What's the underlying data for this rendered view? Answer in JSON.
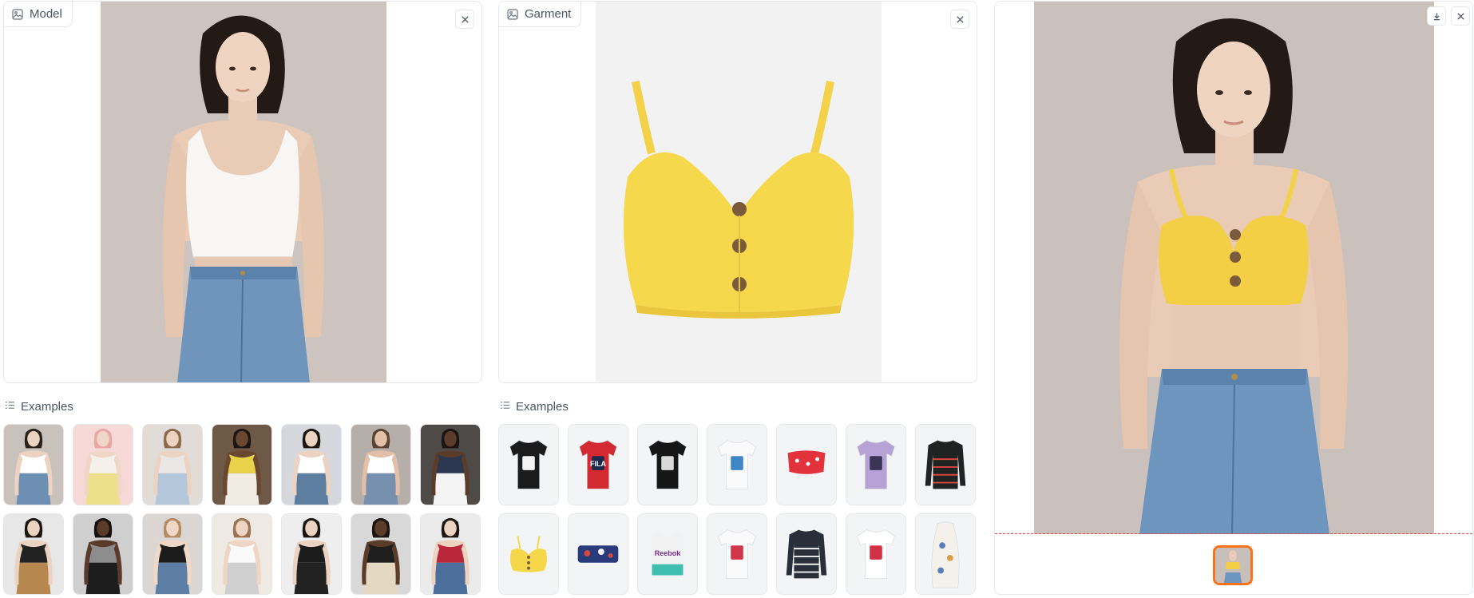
{
  "model_panel": {
    "label": "Model",
    "icon": "image-icon",
    "close_icon": "close-icon"
  },
  "garment_panel": {
    "label": "Garment",
    "icon": "image-icon",
    "close_icon": "close-icon"
  },
  "result_panel": {
    "download_icon": "download-icon",
    "close_icon": "close-icon"
  },
  "model_examples": {
    "label": "Examples",
    "items": [
      {
        "name": "model-white-tank-jeans",
        "top": "#ffffff",
        "bottom": "#6d8fb3",
        "bg": "#c9c1bb",
        "skin": "#ecd2c0",
        "hair": "#2a201c"
      },
      {
        "name": "model-yellow-skirt",
        "top": "#f4f1ea",
        "bottom": "#ece08a",
        "bg": "#f6d9d6",
        "skin": "#f0d6c8",
        "hair": "#e8a7a4"
      },
      {
        "name": "model-gray-tank-jeans",
        "top": "#e9e7e6",
        "bottom": "#b3c6da",
        "bg": "#e1dcd8",
        "skin": "#ecd2c0",
        "hair": "#8b6b4e"
      },
      {
        "name": "model-yellow-crop-skirt",
        "top": "#e8d24a",
        "bottom": "#f1ece3",
        "bg": "#6e5846",
        "skin": "#6a4731",
        "hair": "#1c1612"
      },
      {
        "name": "model-male-white-tank-jeans",
        "top": "#ffffff",
        "bottom": "#5e7e9f",
        "bg": "#d5d7dc",
        "skin": "#ecd2c0",
        "hair": "#1c1612"
      },
      {
        "name": "model-male-tank-jeans",
        "top": "#ffffff",
        "bottom": "#7690ad",
        "bg": "#b5aea9",
        "skin": "#e2bfa6",
        "hair": "#5a4434"
      },
      {
        "name": "model-navy-tank-white-pants",
        "top": "#2b3651",
        "bottom": "#f3f3f3",
        "bg": "#4e4a47",
        "skin": "#5b3c2b",
        "hair": "#1a1512"
      },
      {
        "name": "model-black-sheer-leopard",
        "top": "#222222",
        "bottom": "#b6884f",
        "bg": "#e7e7e7",
        "skin": "#ecd2c0",
        "hair": "#1c1612"
      },
      {
        "name": "model-gray-tee-black-pants",
        "top": "#8d8d8d",
        "bottom": "#1d1d1d",
        "bg": "#cfcfcf",
        "skin": "#5a3a28",
        "hair": "#161210"
      },
      {
        "name": "model-black-tube-jeans",
        "top": "#1c1c1c",
        "bottom": "#5d7fa5",
        "bg": "#d9d6d3",
        "skin": "#f0d7c6",
        "hair": "#b48b64"
      },
      {
        "name": "model-white-top-zebra-skirt",
        "top": "#fafafa",
        "bottom": "#cfcfcf",
        "bg": "#efe9e3",
        "skin": "#efd6c4",
        "hair": "#9a7452"
      },
      {
        "name": "model-black-cami-pants",
        "top": "#1c1c1c",
        "bottom": "#222222",
        "bg": "#eeeeee",
        "skin": "#ecd2c0",
        "hair": "#1c1612"
      },
      {
        "name": "model-black-halter-beige",
        "top": "#1e1e1e",
        "bottom": "#e5d8c2",
        "bg": "#d8d8d8",
        "skin": "#5b3c2b",
        "hair": "#1a1512"
      },
      {
        "name": "model-red-top-jeans",
        "top": "#b8263a",
        "bottom": "#4b6f9a",
        "bg": "#ebebeb",
        "skin": "#ecd2c0",
        "hair": "#1c1612"
      }
    ]
  },
  "garment_examples": {
    "label": "Examples",
    "items": [
      {
        "name": "black-tee-print",
        "kind": "tee",
        "color": "#1b1b1b",
        "accent": "#f3f3f3"
      },
      {
        "name": "fila-tee",
        "kind": "tee",
        "color": "#d32a32",
        "accent": "#1d2a4e",
        "text": "FILA"
      },
      {
        "name": "black-tee-photo",
        "kind": "tee",
        "color": "#161616",
        "accent": "#d9d9d9"
      },
      {
        "name": "white-tee-anime",
        "kind": "tee",
        "color": "#fafafa",
        "accent": "#3f86c9"
      },
      {
        "name": "red-floral-off-shoulder",
        "kind": "crop",
        "color": "#e2333d",
        "accent": "#ffffff"
      },
      {
        "name": "lavender-tee",
        "kind": "tee",
        "color": "#b6a2d4",
        "accent": "#3a3455"
      },
      {
        "name": "black-floral-turtleneck",
        "kind": "long",
        "color": "#1f2422",
        "accent": "#d9453a"
      },
      {
        "name": "yellow-button-cami",
        "kind": "cami",
        "color": "#f5d84a",
        "accent": "#7a5a3a"
      },
      {
        "name": "patterned-tube-top",
        "kind": "tube",
        "color": "#2a3b7c",
        "accent": "#d8483b"
      },
      {
        "name": "reebok-crop-tank",
        "kind": "tank",
        "color": "#f2f2f2",
        "accent": "#7b2d8e",
        "text": "Reebok"
      },
      {
        "name": "white-tee-anime-red",
        "kind": "tee",
        "color": "#fafafa",
        "accent": "#d2344a"
      },
      {
        "name": "striped-long-sleeve",
        "kind": "long",
        "color": "#2a2e38",
        "accent": "#f0f0f0"
      },
      {
        "name": "white-tee-minnie",
        "kind": "tee",
        "color": "#ffffff",
        "accent": "#d23044"
      },
      {
        "name": "floral-bodycon-dress",
        "kind": "dress",
        "color": "#f3f1ea",
        "accent": "#5a7fb6"
      }
    ]
  },
  "colors": {
    "accent": "#f97316",
    "border": "#e5e7eb",
    "text": "#4b5563",
    "result_divider": "#ef4444"
  }
}
